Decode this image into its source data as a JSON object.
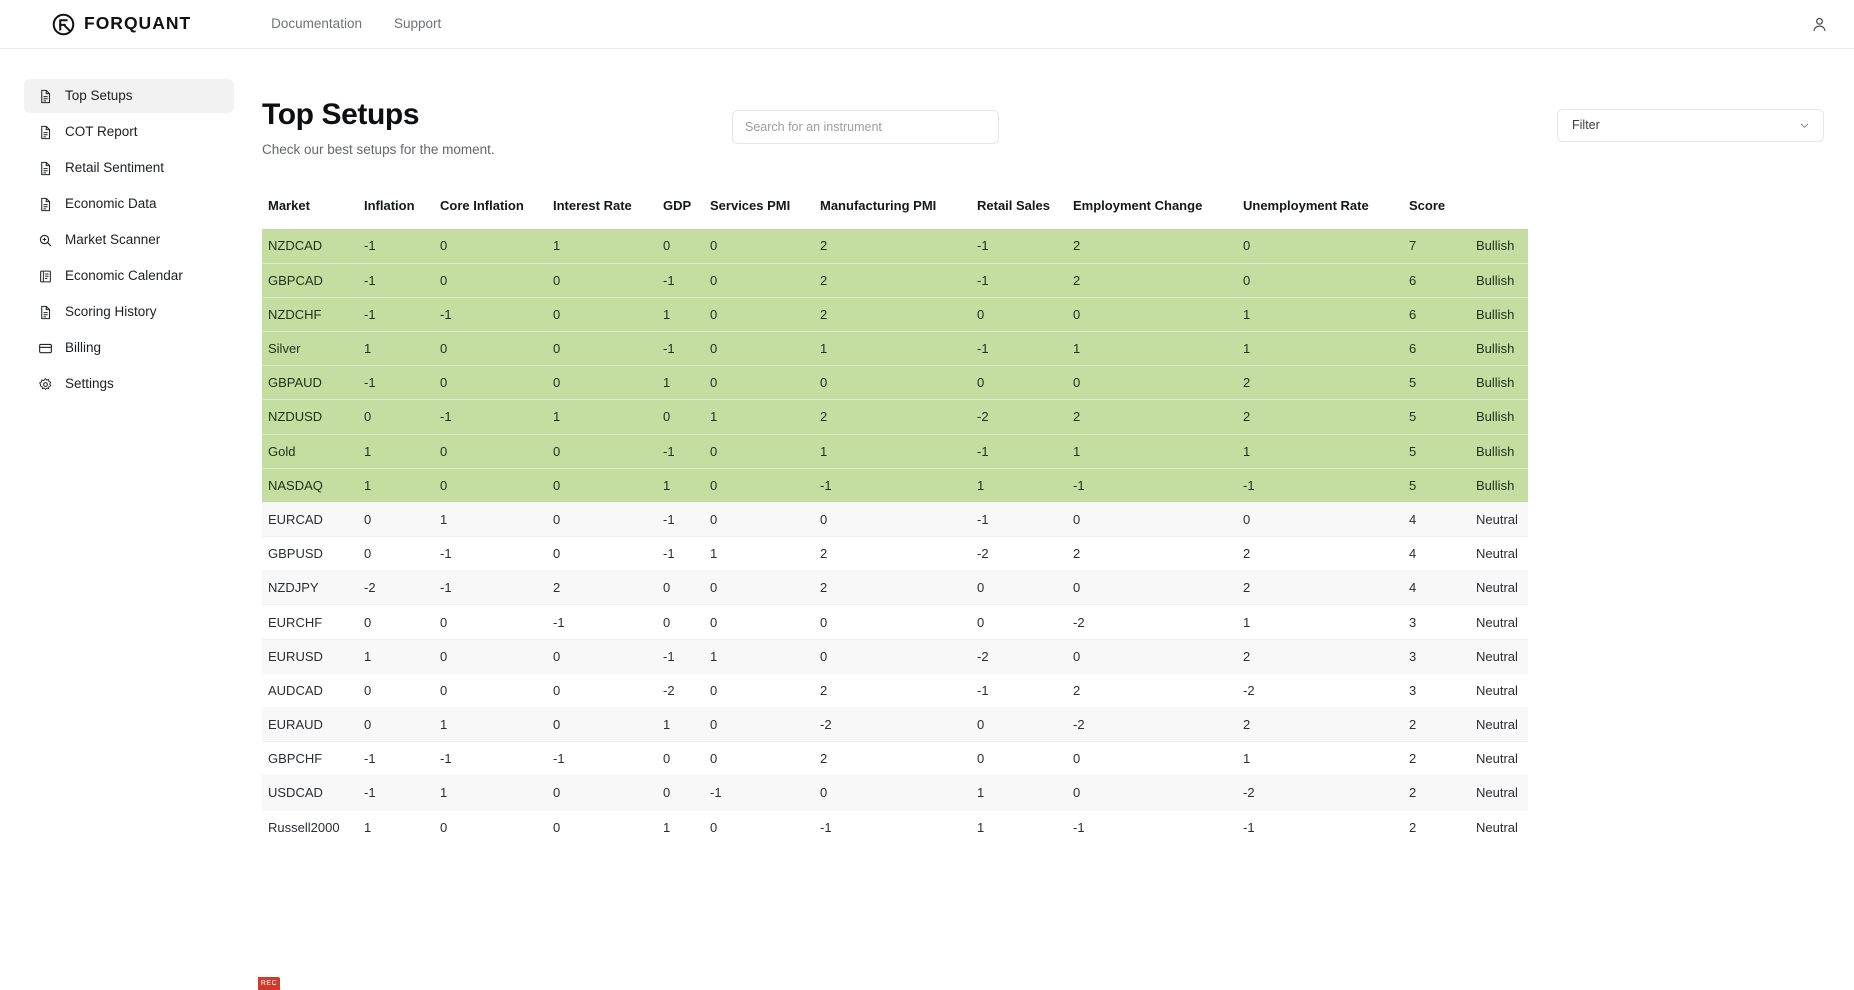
{
  "header": {
    "brand_name": "FORQUANT",
    "brand_icon": "forquant-logo-icon",
    "nav": [
      {
        "label": "Documentation"
      },
      {
        "label": "Support"
      }
    ],
    "account_icon": "user-account-icon"
  },
  "sidebar": {
    "items": [
      {
        "label": "Top Setups",
        "icon": "document-icon",
        "active": true
      },
      {
        "label": "COT Report",
        "icon": "document-icon",
        "active": false
      },
      {
        "label": "Retail Sentiment",
        "icon": "document-icon",
        "active": false
      },
      {
        "label": "Economic Data",
        "icon": "document-icon",
        "active": false
      },
      {
        "label": "Market Scanner",
        "icon": "search-plus-icon",
        "active": false
      },
      {
        "label": "Economic Calendar",
        "icon": "calendar-list-icon",
        "active": false
      },
      {
        "label": "Scoring History",
        "icon": "document-icon",
        "active": false
      },
      {
        "label": "Billing",
        "icon": "credit-card-icon",
        "active": false
      },
      {
        "label": "Settings",
        "icon": "gear-icon",
        "active": false
      }
    ]
  },
  "main": {
    "title": "Top Setups",
    "subtitle": "Check our best setups for the moment.",
    "search": {
      "value": "",
      "placeholder": "Search for an instrument"
    },
    "filter": {
      "label": "Filter",
      "icon": "chevron-down-icon"
    }
  },
  "table": {
    "columns": [
      "Market",
      "Inflation",
      "Core Inflation",
      "Interest Rate",
      "GDP",
      "Services PMI",
      "Manufacturing PMI",
      "Retail Sales",
      "Employment Change",
      "Unemployment Rate",
      "Score",
      ""
    ],
    "rows": [
      {
        "market": "NZDCAD",
        "inflation": "-1",
        "core_inflation": "0",
        "interest_rate": "1",
        "gdp": "0",
        "services_pmi": "0",
        "manufacturing_pmi": "2",
        "retail_sales": "-1",
        "employment_change": "2",
        "unemployment_rate": "0",
        "score": "7",
        "signal": "Bullish",
        "tone": "bullish"
      },
      {
        "market": "GBPCAD",
        "inflation": "-1",
        "core_inflation": "0",
        "interest_rate": "0",
        "gdp": "-1",
        "services_pmi": "0",
        "manufacturing_pmi": "2",
        "retail_sales": "-1",
        "employment_change": "2",
        "unemployment_rate": "0",
        "score": "6",
        "signal": "Bullish",
        "tone": "bullish"
      },
      {
        "market": "NZDCHF",
        "inflation": "-1",
        "core_inflation": "-1",
        "interest_rate": "0",
        "gdp": "1",
        "services_pmi": "0",
        "manufacturing_pmi": "2",
        "retail_sales": "0",
        "employment_change": "0",
        "unemployment_rate": "1",
        "score": "6",
        "signal": "Bullish",
        "tone": "bullish"
      },
      {
        "market": "Silver",
        "inflation": "1",
        "core_inflation": "0",
        "interest_rate": "0",
        "gdp": "-1",
        "services_pmi": "0",
        "manufacturing_pmi": "1",
        "retail_sales": "-1",
        "employment_change": "1",
        "unemployment_rate": "1",
        "score": "6",
        "signal": "Bullish",
        "tone": "bullish"
      },
      {
        "market": "GBPAUD",
        "inflation": "-1",
        "core_inflation": "0",
        "interest_rate": "0",
        "gdp": "1",
        "services_pmi": "0",
        "manufacturing_pmi": "0",
        "retail_sales": "0",
        "employment_change": "0",
        "unemployment_rate": "2",
        "score": "5",
        "signal": "Bullish",
        "tone": "bullish"
      },
      {
        "market": "NZDUSD",
        "inflation": "0",
        "core_inflation": "-1",
        "interest_rate": "1",
        "gdp": "0",
        "services_pmi": "1",
        "manufacturing_pmi": "2",
        "retail_sales": "-2",
        "employment_change": "2",
        "unemployment_rate": "2",
        "score": "5",
        "signal": "Bullish",
        "tone": "bullish"
      },
      {
        "market": "Gold",
        "inflation": "1",
        "core_inflation": "0",
        "interest_rate": "0",
        "gdp": "-1",
        "services_pmi": "0",
        "manufacturing_pmi": "1",
        "retail_sales": "-1",
        "employment_change": "1",
        "unemployment_rate": "1",
        "score": "5",
        "signal": "Bullish",
        "tone": "bullish"
      },
      {
        "market": "NASDAQ",
        "inflation": "1",
        "core_inflation": "0",
        "interest_rate": "0",
        "gdp": "1",
        "services_pmi": "0",
        "manufacturing_pmi": "-1",
        "retail_sales": "1",
        "employment_change": "-1",
        "unemployment_rate": "-1",
        "score": "5",
        "signal": "Bullish",
        "tone": "bullish"
      },
      {
        "market": "EURCAD",
        "inflation": "0",
        "core_inflation": "1",
        "interest_rate": "0",
        "gdp": "-1",
        "services_pmi": "0",
        "manufacturing_pmi": "0",
        "retail_sales": "-1",
        "employment_change": "0",
        "unemployment_rate": "0",
        "score": "4",
        "signal": "Neutral",
        "tone": "neutral-a"
      },
      {
        "market": "GBPUSD",
        "inflation": "0",
        "core_inflation": "-1",
        "interest_rate": "0",
        "gdp": "-1",
        "services_pmi": "1",
        "manufacturing_pmi": "2",
        "retail_sales": "-2",
        "employment_change": "2",
        "unemployment_rate": "2",
        "score": "4",
        "signal": "Neutral",
        "tone": "neutral-b"
      },
      {
        "market": "NZDJPY",
        "inflation": "-2",
        "core_inflation": "-1",
        "interest_rate": "2",
        "gdp": "0",
        "services_pmi": "0",
        "manufacturing_pmi": "2",
        "retail_sales": "0",
        "employment_change": "0",
        "unemployment_rate": "2",
        "score": "4",
        "signal": "Neutral",
        "tone": "neutral-a"
      },
      {
        "market": "EURCHF",
        "inflation": "0",
        "core_inflation": "0",
        "interest_rate": "-1",
        "gdp": "0",
        "services_pmi": "0",
        "manufacturing_pmi": "0",
        "retail_sales": "0",
        "employment_change": "-2",
        "unemployment_rate": "1",
        "score": "3",
        "signal": "Neutral",
        "tone": "neutral-b"
      },
      {
        "market": "EURUSD",
        "inflation": "1",
        "core_inflation": "0",
        "interest_rate": "0",
        "gdp": "-1",
        "services_pmi": "1",
        "manufacturing_pmi": "0",
        "retail_sales": "-2",
        "employment_change": "0",
        "unemployment_rate": "2",
        "score": "3",
        "signal": "Neutral",
        "tone": "neutral-a"
      },
      {
        "market": "AUDCAD",
        "inflation": "0",
        "core_inflation": "0",
        "interest_rate": "0",
        "gdp": "-2",
        "services_pmi": "0",
        "manufacturing_pmi": "2",
        "retail_sales": "-1",
        "employment_change": "2",
        "unemployment_rate": "-2",
        "score": "3",
        "signal": "Neutral",
        "tone": "neutral-b"
      },
      {
        "market": "EURAUD",
        "inflation": "0",
        "core_inflation": "1",
        "interest_rate": "0",
        "gdp": "1",
        "services_pmi": "0",
        "manufacturing_pmi": "-2",
        "retail_sales": "0",
        "employment_change": "-2",
        "unemployment_rate": "2",
        "score": "2",
        "signal": "Neutral",
        "tone": "neutral-a"
      },
      {
        "market": "GBPCHF",
        "inflation": "-1",
        "core_inflation": "-1",
        "interest_rate": "-1",
        "gdp": "0",
        "services_pmi": "0",
        "manufacturing_pmi": "2",
        "retail_sales": "0",
        "employment_change": "0",
        "unemployment_rate": "1",
        "score": "2",
        "signal": "Neutral",
        "tone": "neutral-b"
      },
      {
        "market": "USDCAD",
        "inflation": "-1",
        "core_inflation": "1",
        "interest_rate": "0",
        "gdp": "0",
        "services_pmi": "-1",
        "manufacturing_pmi": "0",
        "retail_sales": "1",
        "employment_change": "0",
        "unemployment_rate": "-2",
        "score": "2",
        "signal": "Neutral",
        "tone": "neutral-a"
      },
      {
        "market": "Russell2000",
        "inflation": "1",
        "core_inflation": "0",
        "interest_rate": "0",
        "gdp": "1",
        "services_pmi": "0",
        "manufacturing_pmi": "-1",
        "retail_sales": "1",
        "employment_change": "-1",
        "unemployment_rate": "-1",
        "score": "2",
        "signal": "Neutral",
        "tone": "neutral-b"
      }
    ]
  },
  "colors": {
    "bullish_row": "#c3dea0",
    "accent_text": "#111111"
  }
}
